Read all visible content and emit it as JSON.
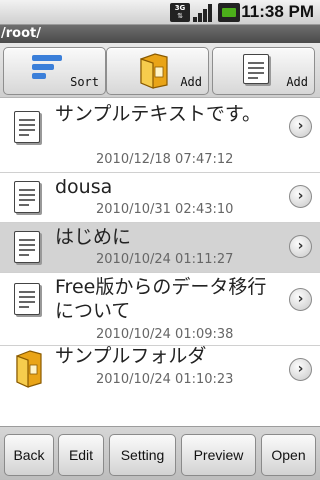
{
  "status_bar": {
    "network_label": "3G",
    "time": "11:38 PM",
    "icons": [
      "3g-data-icon",
      "signal-icon",
      "battery-icon"
    ]
  },
  "path": "/root/",
  "toolbar": {
    "sort_label": "Sort",
    "add_folder_label": "Add",
    "add_file_label": "Add"
  },
  "files": [
    {
      "name": "サンプルテキストです。",
      "date": "2010/12/18 07:47:12",
      "type": "text",
      "selected": false
    },
    {
      "name": "dousa",
      "date": "2010/10/31 02:43:10",
      "type": "text",
      "selected": false
    },
    {
      "name": "はじめに",
      "date": "2010/10/24 01:11:27",
      "type": "text",
      "selected": true
    },
    {
      "name": "Free版からのデータ移行について",
      "date": "2010/10/24 01:09:38",
      "type": "text",
      "selected": false
    },
    {
      "name": "サンプルフォルダ",
      "date": "2010/10/24 01:10:23",
      "type": "folder",
      "selected": false
    }
  ],
  "bottom_bar": {
    "back": "Back",
    "edit": "Edit",
    "setting": "Setting",
    "preview": "Preview",
    "open": "Open"
  },
  "colors": {
    "selected_row": "#d3d3d3",
    "path_bar": "#555555",
    "folder": "#f0b020"
  }
}
